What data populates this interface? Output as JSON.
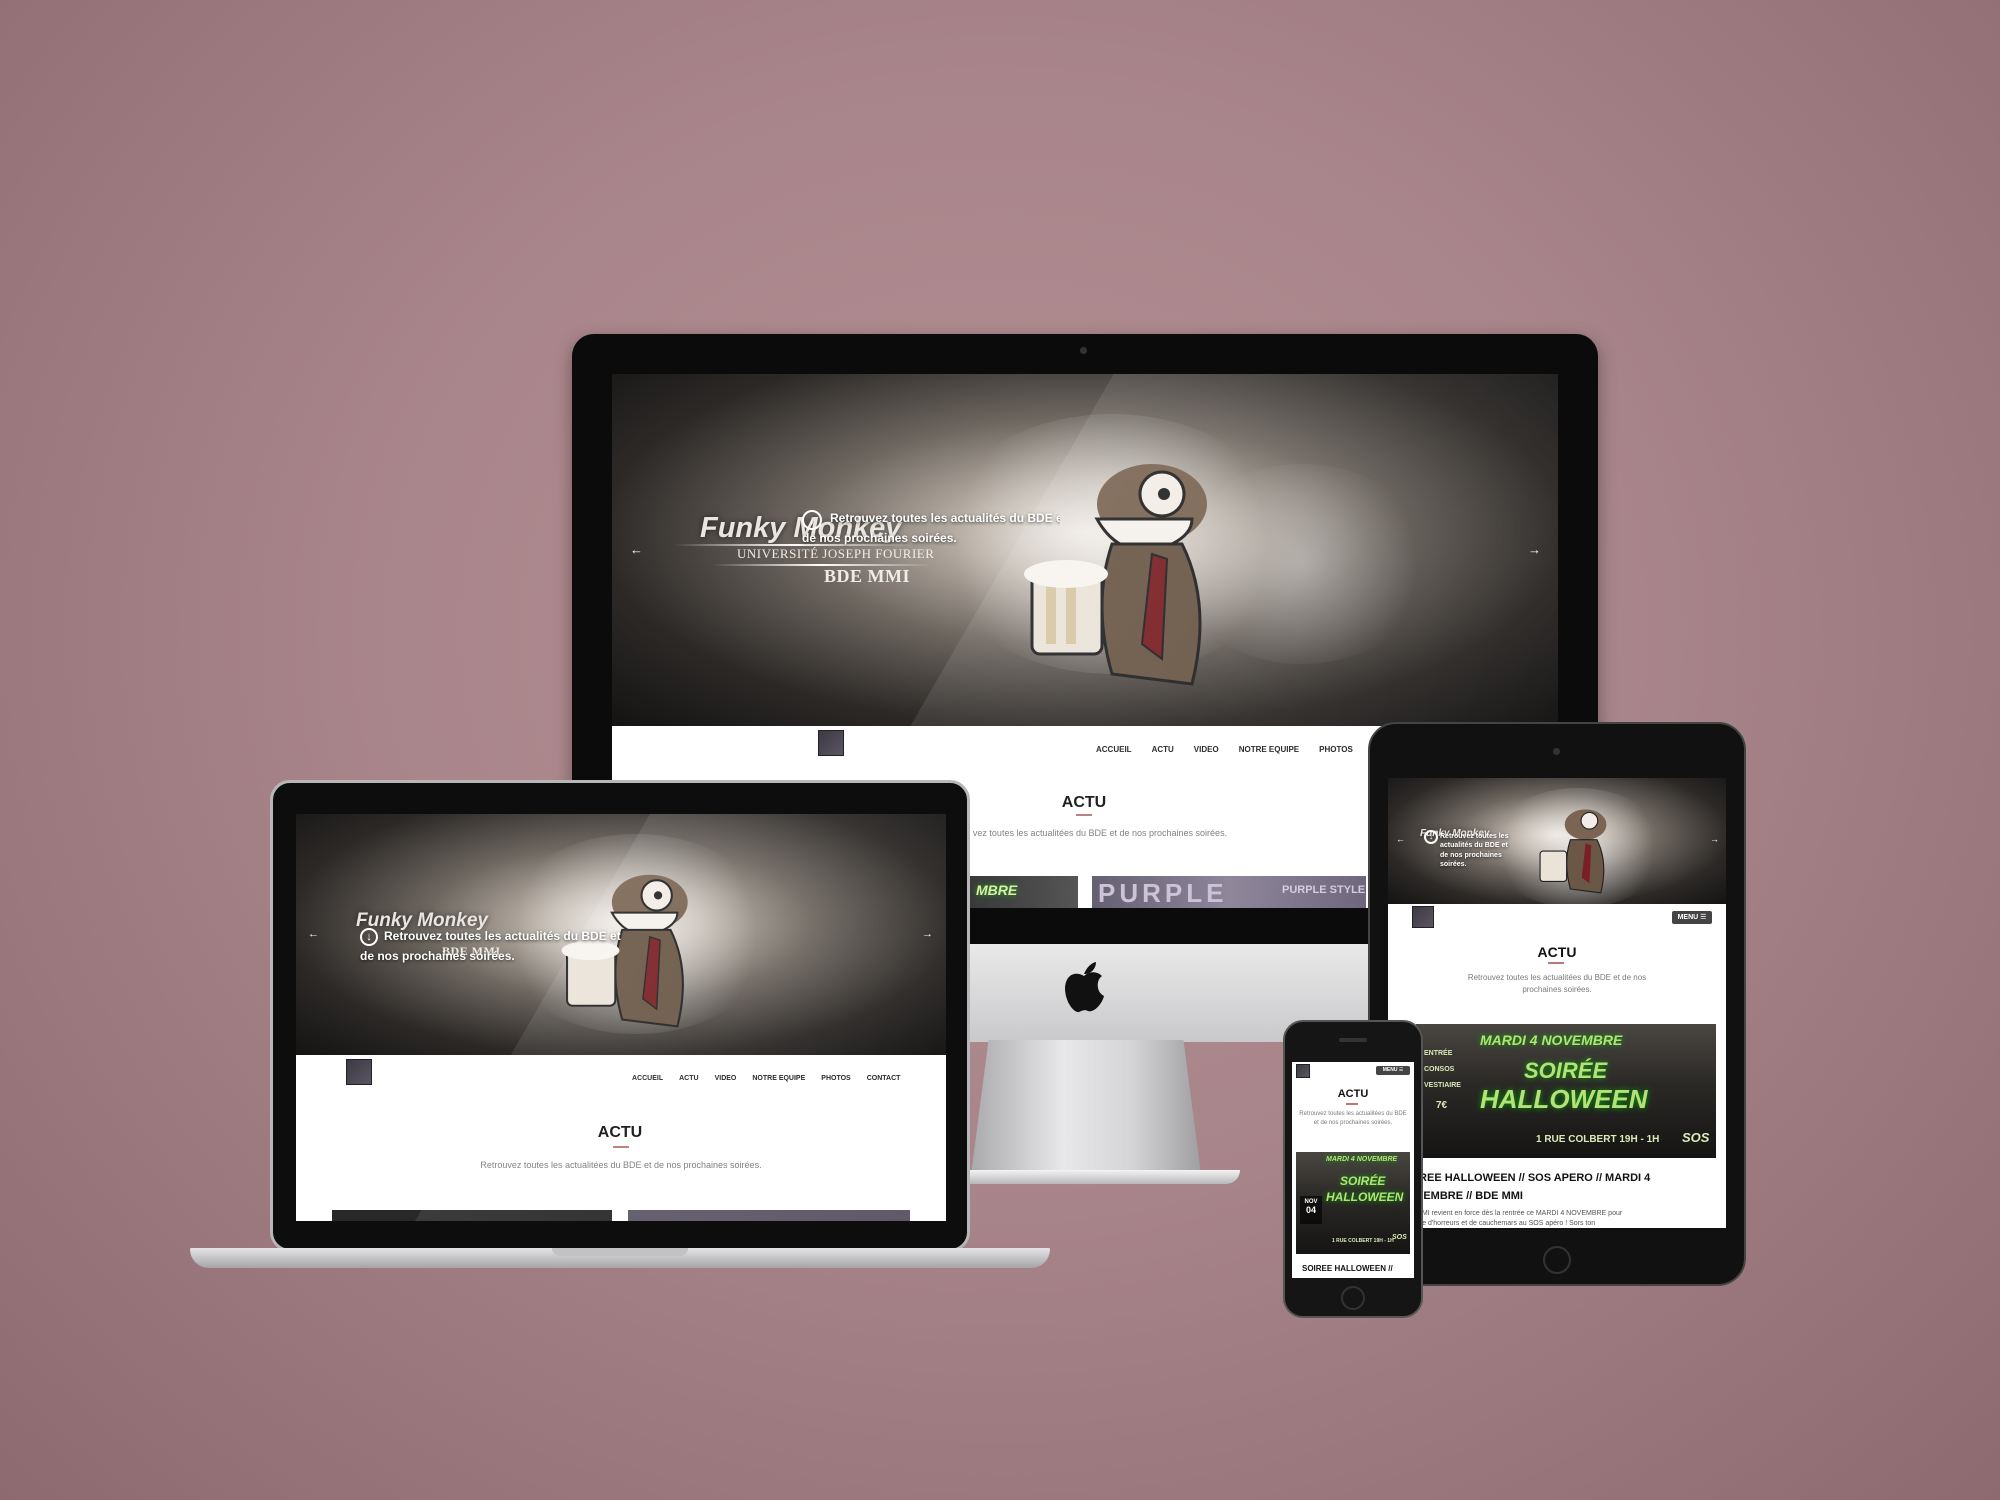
{
  "hero": {
    "logo_title": "Funky Monkey",
    "logo_university": "UNIVERSITÉ JOSEPH FOURIER",
    "logo_bde": "BDE MMI",
    "tagline_line1": "Retrouvez toutes les actualités du BDE et",
    "tagline_line2": "de nos prochaines soirées.",
    "prev_arrow": "←",
    "next_arrow": "→",
    "down_arrow": "↓"
  },
  "nav": {
    "items": [
      "ACCUEIL",
      "ACTU",
      "VIDEO",
      "NOTRE EQUIPE",
      "PHOTOS",
      "CONTACT"
    ],
    "menu_label": "MENU ☰"
  },
  "actu": {
    "title": "ACTU",
    "description": "Retrouvez toutes les actualitées du BDE et de nos prochaines soirées.",
    "description_partial": "vez toutes les actualitées du BDE et de nos prochaines soirées."
  },
  "posts": [
    {
      "poster_title_line1": "MARDI 4 NOVEMBRE",
      "poster_title_line2": "SOIRÉE",
      "poster_title_line3": "HALLOWEEN",
      "poster_left": [
        "ENTRÉE",
        "CONSOS",
        "VESTIAIRE"
      ],
      "poster_price": "7€",
      "poster_address": "1 RUE COLBERT 19H - 1H",
      "poster_tag": "SOS",
      "title_tablet_line1": "IREE HALLOWEEN // SOS APERO // MARDI 4",
      "title_tablet_line2": "VEMBRE // BDE MMI",
      "excerpt_line1": "MMI revient en force dès la rentrée ce MARDI 4 NOVEMBRE pour",
      "excerpt_line2": "rée d'horreurs et de cauchemars au SOS apéro ! Sors ton",
      "title_phone": "SOIREE HALLOWEEN //",
      "date_month": "NOV",
      "date_day": "04"
    }
  ],
  "desktop_thumbs": {
    "thumb1": "MBRE",
    "thumb2": "PURPLE",
    "thumb2_sub": "PURPLE STYLE"
  },
  "colors": {
    "background": "#a8858a",
    "accent_rule": "#b87a76",
    "menu_button": "#444444",
    "poster_text": "#b7e07a"
  }
}
